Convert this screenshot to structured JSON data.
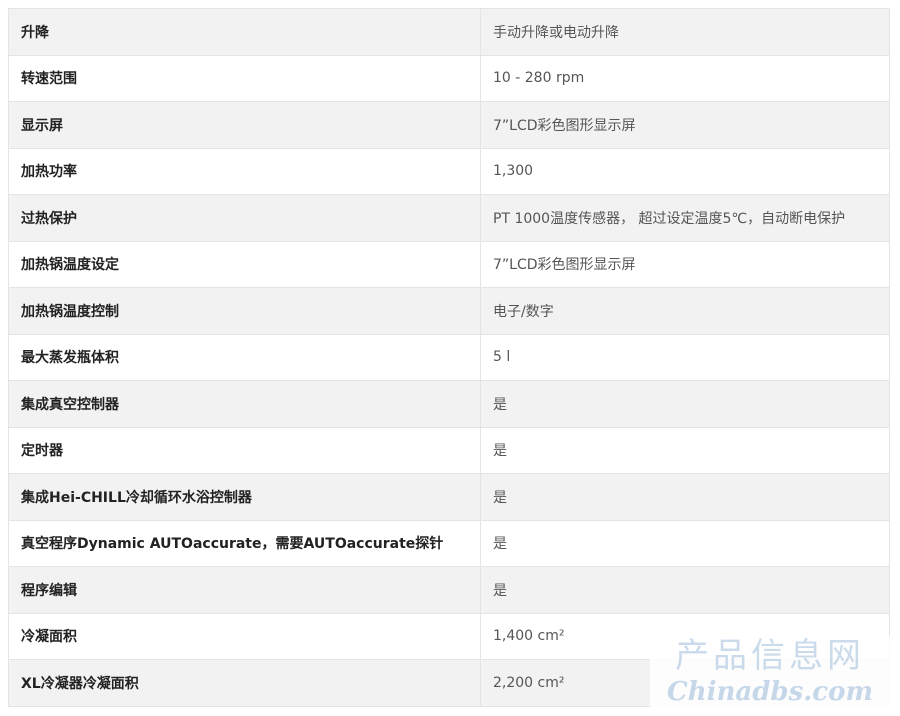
{
  "rows": [
    {
      "key": "升降",
      "value": "手动升降或电动升降"
    },
    {
      "key": "转速范围",
      "value": "10 - 280 rpm"
    },
    {
      "key": "显示屏",
      "value": "7”LCD彩色图形显示屏"
    },
    {
      "key": "加热功率",
      "value": "1,300"
    },
    {
      "key": "过热保护",
      "value": "PT 1000温度传感器， 超过设定温度5℃，自动断电保护"
    },
    {
      "key": "加热锅温度设定",
      "value": "7”LCD彩色图形显示屏"
    },
    {
      "key": "加热锅温度控制",
      "value": "电子/数字"
    },
    {
      "key": "最大蒸发瓶体积",
      "value": "5 l"
    },
    {
      "key": "集成真空控制器",
      "value": "是"
    },
    {
      "key": "定时器",
      "value": "是"
    },
    {
      "key": "集成Hei-CHILL冷却循环水浴控制器",
      "value": "是"
    },
    {
      "key": "真空程序Dynamic AUTOaccurate，需要AUTOaccurate探针",
      "value": "是"
    },
    {
      "key": "程序编辑",
      "value": "是"
    },
    {
      "key": "冷凝面积",
      "value": "1,400 cm²"
    },
    {
      "key": "XL冷凝器冷凝面积",
      "value": "2,200 cm²"
    }
  ],
  "watermark": {
    "cn": "产品信息网",
    "en": "Chinadbs.com"
  }
}
